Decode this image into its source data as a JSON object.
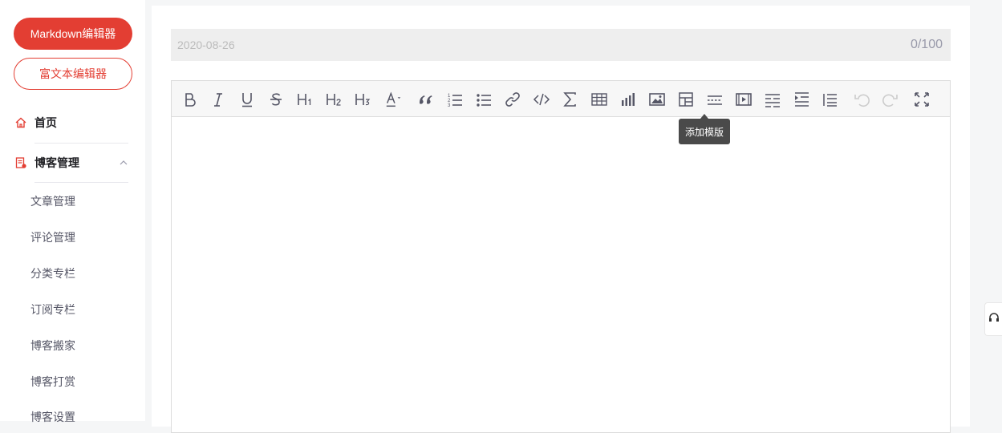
{
  "sidebar": {
    "markdown_button": "Markdown编辑器",
    "richtext_button": "富文本编辑器",
    "home_label": "首页",
    "blog_mgmt_label": "博客管理",
    "sub_items": [
      {
        "label": "文章管理"
      },
      {
        "label": "评论管理"
      },
      {
        "label": "分类专栏"
      },
      {
        "label": "订阅专栏"
      },
      {
        "label": "博客搬家"
      },
      {
        "label": "博客打赏"
      },
      {
        "label": "博客设置"
      }
    ]
  },
  "editor": {
    "title_value": "",
    "title_placeholder": "2020-08-26",
    "char_counter": "0/100",
    "tooltip": "添加模版",
    "toolbar_icons": [
      "bold-icon",
      "italic-icon",
      "underline-icon",
      "strikethrough-icon",
      "heading1-icon",
      "heading2-icon",
      "heading3-icon",
      "text-color-icon",
      "quote-icon",
      "ordered-list-icon",
      "unordered-list-icon",
      "link-icon",
      "code-icon",
      "formula-icon",
      "table-icon",
      "chart-icon",
      "image-icon",
      "template-icon",
      "horizontal-rule-icon",
      "video-icon",
      "toc-icon",
      "indent-icon",
      "outdent-icon",
      "undo-icon",
      "redo-icon",
      "fullscreen-icon"
    ]
  },
  "colors": {
    "brand": "#e33e33",
    "icon_gray": "#555666",
    "disabled_icon": "#cccccc"
  }
}
